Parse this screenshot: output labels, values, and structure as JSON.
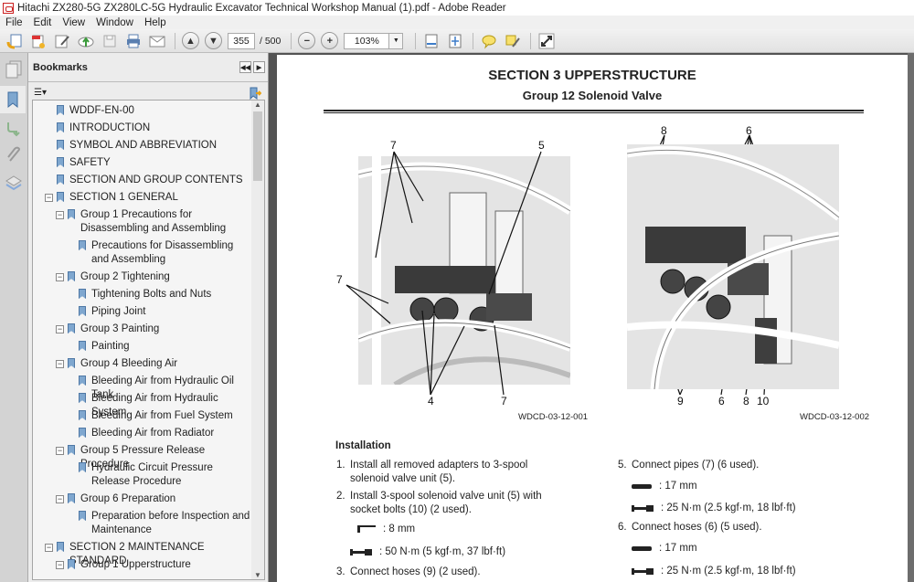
{
  "window": {
    "title": "Hitachi ZX280-5G ZX280LC-5G Hydraulic Excavator Technical Workshop Manual (1).pdf - Adobe Reader"
  },
  "menu": [
    "File",
    "Edit",
    "View",
    "Window",
    "Help"
  ],
  "toolbar": {
    "current_page": "355",
    "total_pages": "/ 500",
    "zoom": "103%",
    "icons": [
      "create-pdf-icon",
      "export-pdf-icon",
      "edit-icon",
      "upload-cloud-icon",
      "save-icon",
      "print-icon",
      "email-icon",
      "prev-page-icon",
      "next-page-icon",
      "zoom-out-icon",
      "zoom-in-icon",
      "fit-width-icon",
      "fit-page-icon",
      "comment-icon",
      "highlight-icon",
      "fullscreen-icon"
    ]
  },
  "sidebar": {
    "title": "Bookmarks",
    "items": [
      {
        "label": "WDDF-EN-00",
        "level": 0
      },
      {
        "label": "INTRODUCTION",
        "level": 0
      },
      {
        "label": "SYMBOL AND ABBREVIATION",
        "level": 0
      },
      {
        "label": "SAFETY",
        "level": 0
      },
      {
        "label": "SECTION AND GROUP CONTENTS",
        "level": 0
      },
      {
        "label": "SECTION 1 GENERAL",
        "level": 0,
        "expanded": true
      },
      {
        "label": "Group 1 Precautions for Disassembling and Assembling",
        "level": 1,
        "expanded": true
      },
      {
        "label": "Precautions for Disassembling and Assembling",
        "level": 2
      },
      {
        "label": "Group 2 Tightening",
        "level": 1,
        "expanded": true
      },
      {
        "label": "Tightening Bolts and Nuts",
        "level": 2
      },
      {
        "label": "Piping Joint",
        "level": 2
      },
      {
        "label": "Group 3 Painting",
        "level": 1,
        "expanded": true
      },
      {
        "label": "Painting",
        "level": 2
      },
      {
        "label": "Group 4 Bleeding Air",
        "level": 1,
        "expanded": true
      },
      {
        "label": "Bleeding Air from Hydraulic Oil Tank",
        "level": 2
      },
      {
        "label": "Bleeding Air from Hydraulic System",
        "level": 2
      },
      {
        "label": "Bleeding Air from Fuel System",
        "level": 2
      },
      {
        "label": "Bleeding Air from Radiator",
        "level": 2
      },
      {
        "label": "Group 5 Pressure Release Procedure",
        "level": 1,
        "expanded": true
      },
      {
        "label": "Hydraulic Circuit Pressure Release Procedure",
        "level": 2
      },
      {
        "label": "Group 6 Preparation",
        "level": 1,
        "expanded": true
      },
      {
        "label": "Preparation before Inspection and Maintenance",
        "level": 2
      },
      {
        "label": "SECTION 2 MAINTENANCE STANDARD",
        "level": 0,
        "expanded": true
      },
      {
        "label": "Group 1 Upperstructure",
        "level": 1,
        "expanded": true
      }
    ]
  },
  "document": {
    "section_title": "SECTION 3 UPPERSTRUCTURE",
    "group_title": "Group 12 Solenoid Valve",
    "figures": [
      {
        "id": "WDCD-03-12-001",
        "callouts": [
          "7",
          "5",
          "7",
          "4",
          "7"
        ]
      },
      {
        "id": "WDCD-03-12-002",
        "callouts": [
          "8",
          "6",
          "9",
          "6",
          "8",
          "10"
        ]
      }
    ],
    "installation_heading": "Installation",
    "steps": [
      {
        "num": "1.",
        "text": "Install all removed adapters to 3-spool solenoid valve unit (5)."
      },
      {
        "num": "2.",
        "text": "Install 3-spool solenoid valve unit (5) with socket bolts (10) (2 used)."
      },
      {
        "num": "3.",
        "text": "Connect hoses (9) (2 used)."
      },
      {
        "num": "5.",
        "text": "Connect pipes (7) (6 used)."
      },
      {
        "num": "6.",
        "text": "Connect hoses (6) (5 used)."
      }
    ],
    "specs": {
      "step2_tool": ": 8 mm",
      "step2_torque": ": 50 N·m (5 kgf·m, 37 lbf·ft)",
      "step5_tool": ": 17 mm",
      "step5_torque": ": 25 N·m (2.5 kgf·m, 18 lbf·ft)",
      "step6_tool": ": 17 mm",
      "step6_torque": ": 25 N·m (2.5 kgf·m, 18 lbf·ft)"
    }
  }
}
